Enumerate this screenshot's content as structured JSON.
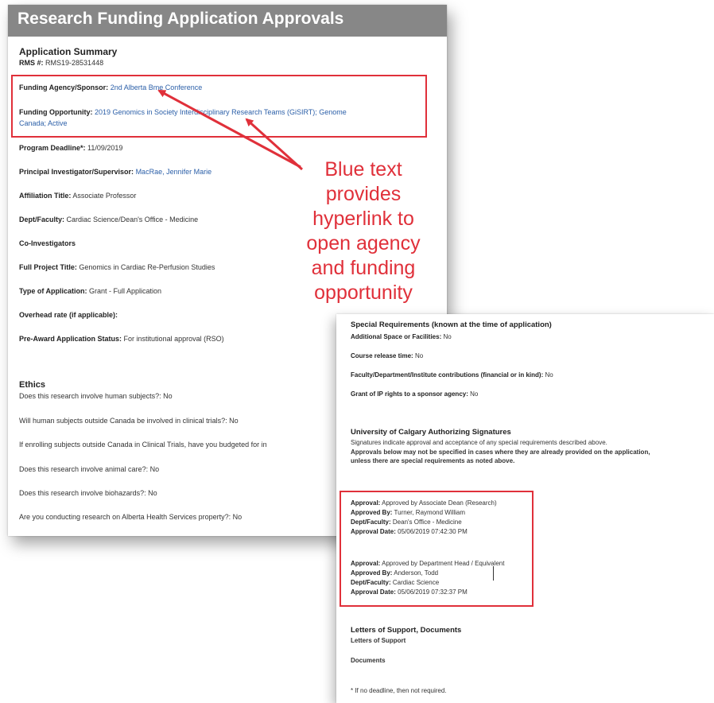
{
  "panel1": {
    "title": "Research Funding Application Approvals",
    "summary_heading": "Application Summary",
    "rms_label": "RMS #:",
    "rms_value": "RMS19-28531448",
    "funding_agency_label": "Funding Agency/Sponsor:",
    "funding_agency_value": "2nd Alberta Bme Conference",
    "funding_opportunity_label": "Funding Opportunity:",
    "funding_opportunity_value_1": "2019 Genomics in Society Interdisciplinary Research Teams (GiSIRT); Genome",
    "funding_opportunity_value_2": "Canada; Active",
    "program_deadline_label": "Program Deadline*:",
    "program_deadline_value": "11/09/2019",
    "pi_label": "Principal Investigator/Supervisor:",
    "pi_value": "MacRae, Jennifer Marie",
    "affiliation_label": "Affiliation Title:",
    "affiliation_value": "Associate Professor",
    "dept_label": "Dept/Faculty:",
    "dept_value": "Cardiac Science/Dean's Office - Medicine",
    "co_investigators_label": "Co-Investigators",
    "project_title_label": "Full Project Title:",
    "project_title_value": "Genomics in Cardiac Re-Perfusion Studies",
    "app_type_label": "Type of Application:",
    "app_type_value": "Grant - Full Application",
    "overhead_label": "Overhead rate (if applicable):",
    "status_label": "Pre-Award Application Status:",
    "status_value": "For institutional approval (RSO)",
    "ethics_heading": "Ethics",
    "ethics_q1": "Does this research involve human subjects?:",
    "ethics_a1": "No",
    "ethics_q2": "Will human subjects outside Canada be involved in clinical trials?:",
    "ethics_a2": "No",
    "ethics_q3": "If enrolling subjects outside Canada in Clinical Trials, have you budgeted for in",
    "ethics_q4": "Does this research involve animal care?:",
    "ethics_a4": "No",
    "ethics_q5": "Does this research involve biohazards?:",
    "ethics_a5": "No",
    "ethics_q6": "Are you conducting research on Alberta Health Services property?:",
    "ethics_a6": "No"
  },
  "annotation": {
    "lines": [
      "Blue text",
      "provides",
      "hyperlink to",
      "open agency",
      "and funding",
      "opportunity"
    ],
    "color": "#e0303a"
  },
  "panel2": {
    "special_heading": "Special Requirements (known at the time of application)",
    "space_label": "Additional Space or Facilities:",
    "space_value": "No",
    "course_label": "Course release time:",
    "course_value": "No",
    "contrib_label": "Faculty/Department/Institute contributions (financial or in kind):",
    "contrib_value": "No",
    "ip_label": "Grant of IP rights to a sponsor agency:",
    "ip_value": "No",
    "sig_heading": "University of Calgary Authorizing Signatures",
    "sig_note": "Signatures indicate approval and acceptance of any special requirements described above.",
    "sig_note_b1": "Approvals below may not be specified in cases where they are already provided on the application,",
    "sig_note_b2": "unless there are special requirements as noted above.",
    "approval1": {
      "approval_label": "Approval:",
      "approval_value": "Approved by Associate Dean (Research)",
      "by_label": "Approved By:",
      "by_value": "Turner, Raymond William",
      "dept_label": "Dept/Faculty:",
      "dept_value": "Dean's Office - Medicine",
      "date_label": "Approval Date:",
      "date_value": "05/06/2019 07:42:30 PM"
    },
    "approval2": {
      "approval_label": "Approval:",
      "approval_value": "Approved by Department Head / Equivalent",
      "by_label": "Approved By:",
      "by_value": "Anderson, Todd",
      "dept_label": "Dept/Faculty:",
      "dept_value": "Cardiac Science",
      "date_label": "Approval Date:",
      "date_value": "05/06/2019 07:32:37 PM"
    },
    "letters_heading": "Letters of Support, Documents",
    "letters_label": "Letters of Support",
    "documents_label": "Documents",
    "footnote": "* If no deadline, then not required."
  }
}
